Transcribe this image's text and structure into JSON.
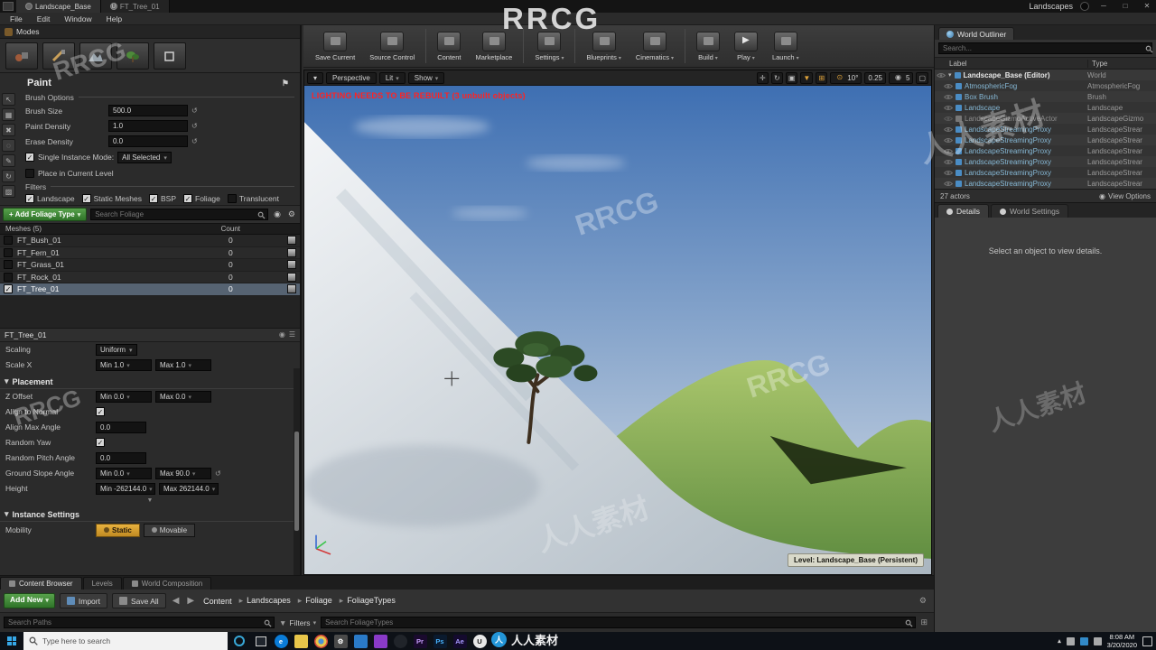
{
  "watermarks": {
    "brand": "RRCG",
    "brand_cn": "人人素材"
  },
  "titlebar": {
    "tabs": [
      {
        "label": "Landscape_Base"
      },
      {
        "label": "FT_Tree_01"
      }
    ],
    "project_label": "Landscapes",
    "window_controls": {
      "minimize": "─",
      "maximize": "□",
      "close": "✕"
    }
  },
  "menubar": {
    "items": [
      "File",
      "Edit",
      "Window",
      "Help"
    ]
  },
  "main_toolbar": {
    "buttons": [
      {
        "label": "Save Current"
      },
      {
        "label": "Source Control"
      },
      {
        "label": "Content"
      },
      {
        "label": "Marketplace"
      },
      {
        "label": "Settings"
      },
      {
        "label": "Blueprints"
      },
      {
        "label": "Cinematics"
      },
      {
        "label": "Build"
      },
      {
        "label": "Play"
      },
      {
        "label": "Launch"
      }
    ]
  },
  "modes_panel": {
    "title": "Modes",
    "section_title": "Paint",
    "brush_options_title": "Brush Options",
    "brush_fields": [
      {
        "label": "Brush Size",
        "value": "500.0"
      },
      {
        "label": "Paint Density",
        "value": "1.0"
      },
      {
        "label": "Erase Density",
        "value": "0.0"
      }
    ],
    "single_instance_label": "Single Instance Mode:",
    "single_instance_value": "All Selected",
    "single_instance_checked": true,
    "place_in_level_label": "Place in Current Level",
    "place_in_level_checked": false,
    "filters_title": "Filters",
    "filters": [
      {
        "label": "Landscape",
        "checked": true
      },
      {
        "label": "Static Meshes",
        "checked": true
      },
      {
        "label": "BSP",
        "checked": true
      },
      {
        "label": "Foliage",
        "checked": true
      },
      {
        "label": "Translucent",
        "checked": false
      }
    ]
  },
  "foliage_palette": {
    "add_button_label": "+ Add Foliage Type",
    "search_placeholder": "Search Foliage",
    "list_header": "Meshes (5)",
    "count_header": "Count",
    "items": [
      {
        "name": "FT_Bush_01",
        "count": "0",
        "checked": false
      },
      {
        "name": "FT_Fern_01",
        "count": "0",
        "checked": false
      },
      {
        "name": "FT_Grass_01",
        "count": "0",
        "checked": false
      },
      {
        "name": "FT_Rock_01",
        "count": "0",
        "checked": false
      },
      {
        "name": "FT_Tree_01",
        "count": "0",
        "checked": true
      }
    ]
  },
  "mesh_details": {
    "title": "FT_Tree_01",
    "scaling_label": "Scaling",
    "scaling_value": "Uniform",
    "scale_x_label": "Scale X",
    "scale_x_min": "Min 1.0",
    "scale_x_max": "Max 1.0",
    "placement_title": "Placement",
    "z_offset_label": "Z Offset",
    "z_offset_min": "Min 0.0",
    "z_offset_max": "Max 0.0",
    "align_label": "Align to Normal",
    "align_checked": true,
    "align_max_angle_label": "Align Max Angle",
    "align_max_angle": "0.0",
    "random_yaw_label": "Random Yaw",
    "random_yaw_checked": true,
    "random_pitch_label": "Random Pitch Angle",
    "random_pitch": "0.0",
    "slope_label": "Ground Slope Angle",
    "slope_min": "Min 0.0",
    "slope_max": "Max 90.0",
    "height_label": "Height",
    "height_min": "Min -262144.0",
    "height_max": "Max 262144.0",
    "instance_settings_title": "Instance Settings",
    "mobility_label": "Mobility",
    "mobility_static": "Static",
    "mobility_movable": "Movable"
  },
  "content_browser": {
    "tabs": [
      {
        "label": "Content Browser"
      },
      {
        "label": "Levels"
      },
      {
        "label": "World Composition"
      }
    ],
    "add_new_label": "Add New",
    "import_label": "Import",
    "save_all_label": "Save All",
    "breadcrumb": [
      "Content",
      "Landscapes",
      "Foliage",
      "FoliageTypes"
    ],
    "search_paths_placeholder": "Search Paths",
    "filters_label": "Filters",
    "search_assets_placeholder": "Search FoliageTypes"
  },
  "viewport": {
    "toolbar": {
      "perspective": "Perspective",
      "lit": "Lit",
      "show": "Show",
      "rotation_snap": "10°",
      "scale_snap": "0.25",
      "camera_speed": "5"
    },
    "warning": "LIGHTING NEEDS TO BE REBUILT (3 unbuilt objects)",
    "level_badge": "Level:  Landscape_Base (Persistent)"
  },
  "world_outliner": {
    "title": "World Outliner",
    "search_placeholder": "Search...",
    "columns": {
      "label": "Label",
      "type": "Type"
    },
    "rows": [
      {
        "label": "Landscape_Base (Editor)",
        "type": "World"
      },
      {
        "label": "AtmosphericFog",
        "type": "AtmosphericFog"
      },
      {
        "label": "Box Brush",
        "type": "Brush"
      },
      {
        "label": "Landscape",
        "type": "Landscape"
      },
      {
        "label": "LandscapeGizmoActiveActor",
        "type": "LandscapeGizmo"
      },
      {
        "label": "LandscapeStreamingProxy",
        "type": "LandscapeStrear"
      },
      {
        "label": "LandscapeStreamingProxy",
        "type": "LandscapeStrear"
      },
      {
        "label": "LandscapeStreamingProxy",
        "type": "LandscapeStrear"
      },
      {
        "label": "LandscapeStreamingProxy",
        "type": "LandscapeStrear"
      },
      {
        "label": "LandscapeStreamingProxy",
        "type": "LandscapeStrear"
      },
      {
        "label": "LandscapeStreamingProxy",
        "type": "LandscapeStrear"
      }
    ],
    "footer_left": "27 actors",
    "footer_right": "View Options"
  },
  "details_panel": {
    "tabs": [
      {
        "label": "Details"
      },
      {
        "label": "World Settings"
      }
    ],
    "empty_text": "Select an object to view details."
  },
  "taskbar": {
    "search_placeholder": "Type here to search",
    "time": "8:08 AM",
    "date": "3/20/2020",
    "app_icons": [
      {
        "name": "edge",
        "label": "e"
      },
      {
        "name": "file-explorer",
        "label": ""
      },
      {
        "name": "chrome",
        "label": ""
      },
      {
        "name": "settings",
        "label": ""
      },
      {
        "name": "photos",
        "label": ""
      },
      {
        "name": "media-player",
        "label": ""
      },
      {
        "name": "obs",
        "label": ""
      },
      {
        "name": "premiere",
        "label": "Pr"
      },
      {
        "name": "photoshop",
        "label": "Ps"
      },
      {
        "name": "after-effects",
        "label": "Ae"
      },
      {
        "name": "unreal",
        "label": "U"
      }
    ]
  }
}
